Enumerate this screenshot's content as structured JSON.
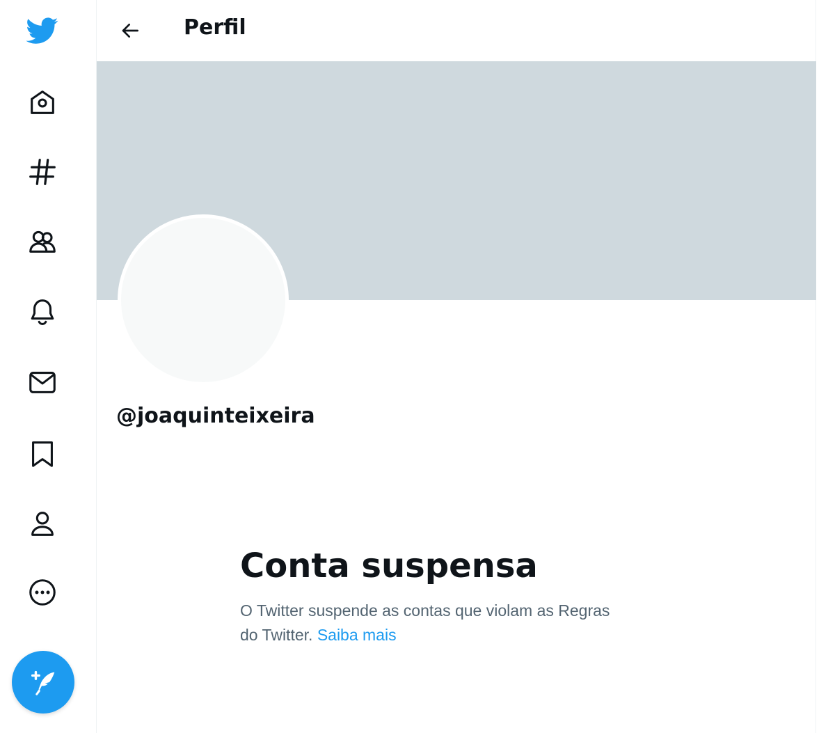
{
  "colors": {
    "accent": "#1d9bf0",
    "banner": "#cfd9de",
    "avatar": "#f7f9f9",
    "text_primary": "#0f1419",
    "text_secondary": "#536471"
  },
  "sidebar": {
    "items": [
      {
        "icon": "twitter-bird-logo"
      },
      {
        "icon": "home-icon"
      },
      {
        "icon": "hashtag-icon"
      },
      {
        "icon": "communities-icon"
      },
      {
        "icon": "bell-icon"
      },
      {
        "icon": "envelope-icon"
      },
      {
        "icon": "bookmark-icon"
      },
      {
        "icon": "profile-icon"
      },
      {
        "icon": "more-icon"
      }
    ],
    "compose_icon": "feather-plus-icon"
  },
  "header": {
    "back_icon": "arrow-left-icon",
    "title": "Perfil"
  },
  "profile": {
    "handle": "@joaquinteixeira"
  },
  "suspension": {
    "title": "Conta suspensa",
    "message_line1": "O Twitter suspende as contas que violam as Regras",
    "message_line2": "do Twitter.",
    "learn_more": "Saiba mais"
  }
}
